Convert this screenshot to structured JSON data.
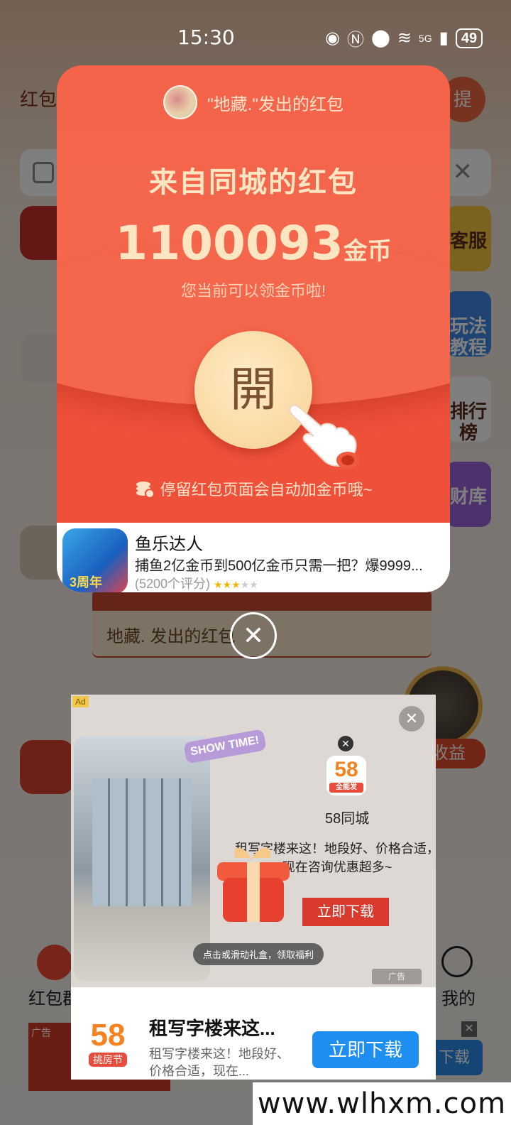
{
  "status_bar": {
    "time": "15:30",
    "battery": "49",
    "network": "5G"
  },
  "background_app": {
    "title": "红包",
    "withdraw_label": "提",
    "side_buttons": [
      "客服",
      "玩法教程",
      "排行榜",
      "财库"
    ],
    "card_label": "地藏. 发出的红包",
    "income_label": "收益",
    "nav_items": [
      "红包群",
      "我的"
    ],
    "tile_label": "红包群",
    "bottom_ad_tag": "广告",
    "bottom_ad_download": "下载"
  },
  "red_packet": {
    "sender": "\"地藏.\"发出的红包",
    "title": "来自同城的红包",
    "amount": "1100093",
    "unit": "金币",
    "hint": "您当前可以领金币啦!",
    "open_label": "開",
    "auto_tip": "停留红包页面会自动加金币哦~",
    "ad": {
      "name": "鱼乐达人",
      "desc": "捕鱼2亿金币到500亿金币只需一把？爆9999...",
      "rating_text": "(5200个评分)",
      "stars": 3,
      "icon_badge": "3周年"
    }
  },
  "ad_panel": {
    "tag": "Ad",
    "show_time": "SHOW TIME!",
    "brand_logo": "58",
    "brand_logo_sub": "全能发",
    "brand_name": "58同城",
    "copy": "租写字楼来这！地段好、价格合适，现在咨询优惠超多~",
    "download": "立即下载",
    "tip": "点击或滑动礼盒，领取福利",
    "small_tag": "广告"
  },
  "ad_bar": {
    "logo": "58",
    "logo_sub": "挑房节",
    "title": "租写字楼来这...",
    "desc": "租写字楼来这！地段好、价格合适，现在...",
    "button": "立即下载"
  },
  "watermark": "www.wlhxm.com",
  "colors": {
    "packet_red": "#f25a3e",
    "gold_text": "#ffe6c2",
    "open_button": "#f8d093",
    "download_blue": "#1e8ff0"
  }
}
